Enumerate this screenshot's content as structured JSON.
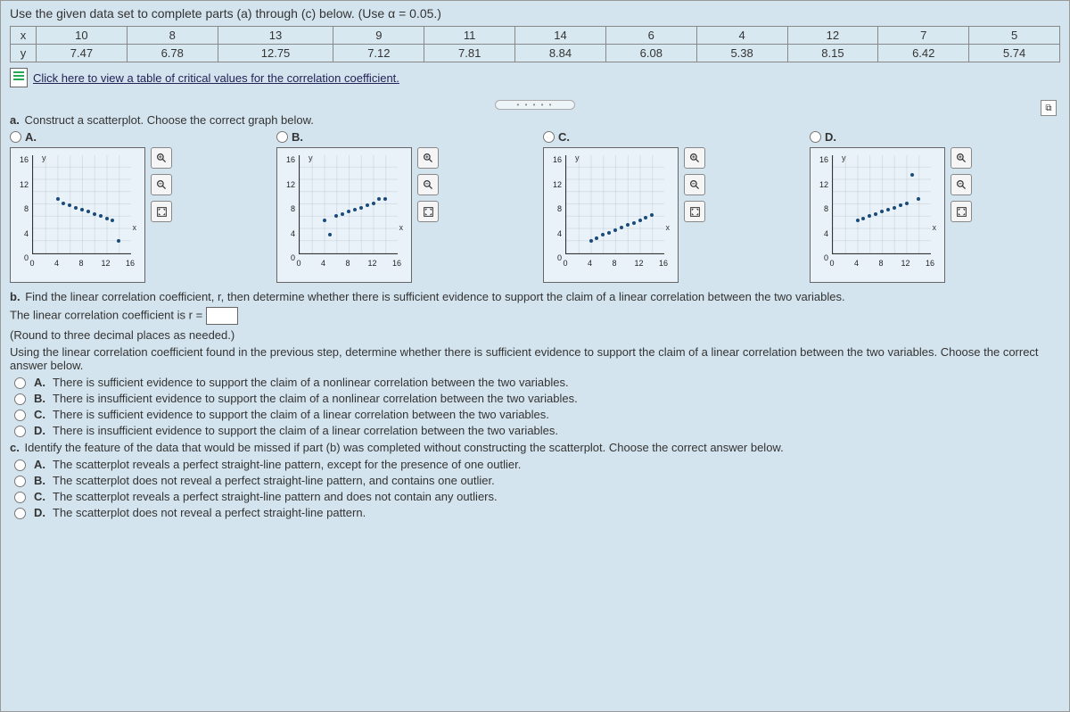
{
  "header": "Use the given data set to complete parts (a) through (c) below. (Use α = 0.05.)",
  "table": {
    "row_labels": [
      "x",
      "y"
    ],
    "x": [
      "10",
      "8",
      "13",
      "9",
      "11",
      "14",
      "6",
      "4",
      "12",
      "7",
      "5"
    ],
    "y": [
      "7.47",
      "6.78",
      "12.75",
      "7.12",
      "7.81",
      "8.84",
      "6.08",
      "5.38",
      "8.15",
      "6.42",
      "5.74"
    ]
  },
  "critical_link": "Click here to view a table of critical values for the correlation coefficient.",
  "part_a": {
    "label": "a.",
    "text": "Construct a scatterplot. Choose the correct graph below."
  },
  "options": {
    "labels": [
      "A.",
      "B.",
      "C.",
      "D."
    ],
    "axis": {
      "ymax": 16,
      "xmax": 16,
      "ylabel": "y",
      "xlabel": "x",
      "yticks": [
        0,
        4,
        8,
        12,
        16
      ],
      "xticks": [
        0,
        4,
        8,
        12,
        16
      ]
    }
  },
  "chart_data": [
    {
      "id": "A",
      "type": "scatter",
      "xlim": [
        0,
        16
      ],
      "ylim": [
        0,
        16
      ],
      "title": "",
      "xlabel": "x",
      "ylabel": "y",
      "points": [
        [
          4,
          8.84
        ],
        [
          5,
          8.15
        ],
        [
          6,
          7.81
        ],
        [
          7,
          7.47
        ],
        [
          8,
          7.12
        ],
        [
          9,
          6.78
        ],
        [
          10,
          6.42
        ],
        [
          11,
          6.08
        ],
        [
          12,
          5.74
        ],
        [
          13,
          5.38
        ],
        [
          14,
          2.0
        ]
      ]
    },
    {
      "id": "B",
      "type": "scatter",
      "xlim": [
        0,
        16
      ],
      "ylim": [
        0,
        16
      ],
      "title": "",
      "xlabel": "x",
      "ylabel": "y",
      "points": [
        [
          4,
          5.38
        ],
        [
          5,
          3.0
        ],
        [
          6,
          6.08
        ],
        [
          7,
          6.42
        ],
        [
          8,
          6.78
        ],
        [
          9,
          7.12
        ],
        [
          10,
          7.47
        ],
        [
          11,
          7.81
        ],
        [
          12,
          8.15
        ],
        [
          13,
          8.84
        ],
        [
          14,
          8.84
        ]
      ]
    },
    {
      "id": "C",
      "type": "scatter",
      "xlim": [
        0,
        16
      ],
      "ylim": [
        0,
        16
      ],
      "title": "",
      "xlabel": "x",
      "ylabel": "y",
      "points": [
        [
          4,
          2.0
        ],
        [
          5,
          2.5
        ],
        [
          6,
          3.0
        ],
        [
          7,
          3.4
        ],
        [
          8,
          3.8
        ],
        [
          9,
          4.2
        ],
        [
          10,
          4.6
        ],
        [
          11,
          5.0
        ],
        [
          12,
          5.4
        ],
        [
          13,
          5.8
        ],
        [
          14,
          6.2
        ]
      ]
    },
    {
      "id": "D",
      "type": "scatter",
      "xlim": [
        0,
        16
      ],
      "ylim": [
        0,
        16
      ],
      "title": "",
      "xlabel": "x",
      "ylabel": "y",
      "points": [
        [
          4,
          5.38
        ],
        [
          5,
          5.74
        ],
        [
          6,
          6.08
        ],
        [
          7,
          6.42
        ],
        [
          8,
          6.78
        ],
        [
          9,
          7.12
        ],
        [
          10,
          7.47
        ],
        [
          11,
          7.81
        ],
        [
          12,
          8.15
        ],
        [
          13,
          12.75
        ],
        [
          14,
          8.84
        ]
      ]
    }
  ],
  "part_b": {
    "label": "b.",
    "text": "Find the linear correlation coefficient, r, then determine whether there is sufficient evidence to support the claim of a linear correlation between the two variables.",
    "coef_line": "The linear correlation coefficient is r =",
    "round_note": "(Round to three decimal places as needed.)",
    "followup": "Using the linear correlation coefficient found in the previous step, determine whether there is sufficient evidence to support the claim of a linear correlation between the two variables. Choose the correct answer below.",
    "answers": [
      "There is sufficient evidence to support the claim of a nonlinear correlation between the two variables.",
      "There is insufficient evidence to support the claim of a nonlinear correlation between the two variables.",
      "There is sufficient evidence to support the claim of a linear correlation between the two variables.",
      "There is insufficient evidence to support the claim of a linear correlation between the two variables."
    ],
    "answer_labels": [
      "A.",
      "B.",
      "C.",
      "D."
    ]
  },
  "part_c": {
    "label": "c.",
    "text": "Identify the feature of the data that would be missed if part (b) was completed without constructing the scatterplot. Choose the correct answer below.",
    "answers": [
      "The scatterplot reveals a perfect straight-line pattern, except for the presence of one outlier.",
      "The scatterplot does not reveal a perfect straight-line pattern, and contains one outlier.",
      "The scatterplot reveals a perfect straight-line pattern and does not contain any outliers.",
      "The scatterplot does not reveal a perfect straight-line pattern."
    ],
    "answer_labels": [
      "A.",
      "B.",
      "C.",
      "D."
    ]
  }
}
